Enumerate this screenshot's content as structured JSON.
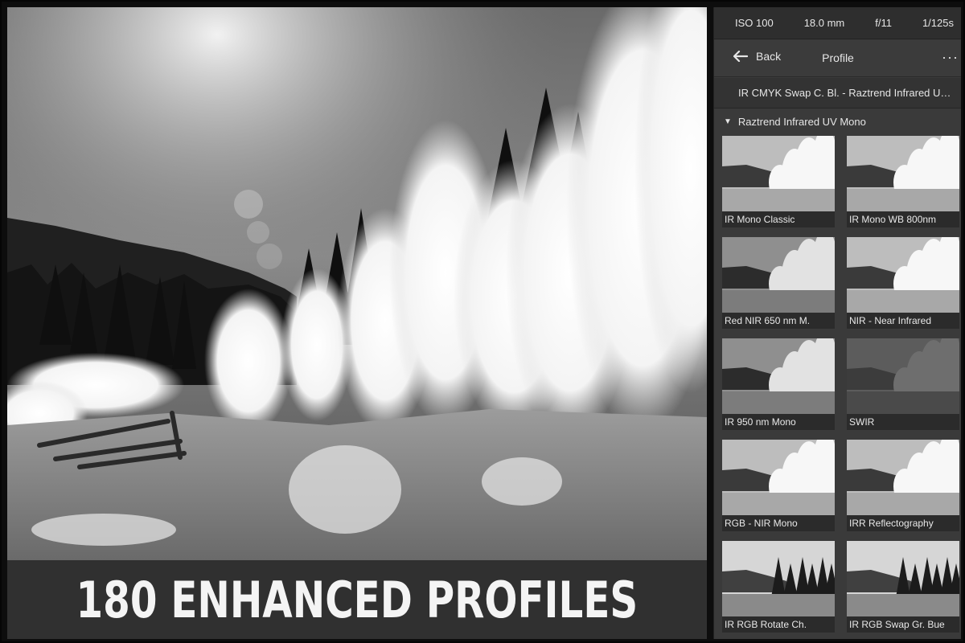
{
  "exif": {
    "iso": "ISO 100",
    "focal_length": "18.0 mm",
    "aperture": "f/11",
    "shutter": "1/125s"
  },
  "navbar": {
    "back_label": "Back",
    "title": "Profile",
    "more_label": "···"
  },
  "profile_select": {
    "value": "IR CMYK Swap C. Bl. - Raztrend Infrared UV Mono"
  },
  "group": {
    "caret": "▼",
    "name": "Raztrend Infrared UV Mono"
  },
  "profiles": [
    {
      "label": "IR Mono Classic",
      "style": "bright"
    },
    {
      "label": "IR Mono WB 800nm",
      "style": "bright"
    },
    {
      "label": "Red NIR 650 nm M.",
      "style": "mid"
    },
    {
      "label": "NIR - Near Infrared",
      "style": "bright"
    },
    {
      "label": "IR 950 nm Mono",
      "style": "mid"
    },
    {
      "label": "SWIR",
      "style": "dark"
    },
    {
      "label": "RGB - NIR Mono",
      "style": "bright"
    },
    {
      "label": "IRR Reflectography",
      "style": "bright"
    },
    {
      "label": "IR RGB Rotate Ch.",
      "style": "forest"
    },
    {
      "label": "IR RGB Swap Gr. Bue",
      "style": "forest"
    }
  ],
  "banner": {
    "text": "180 ENHANCED PROFILES"
  },
  "colors": {
    "panel_bg": "#3a3a3a",
    "banner_bg": "#303030",
    "text": "#e6e6e6"
  }
}
